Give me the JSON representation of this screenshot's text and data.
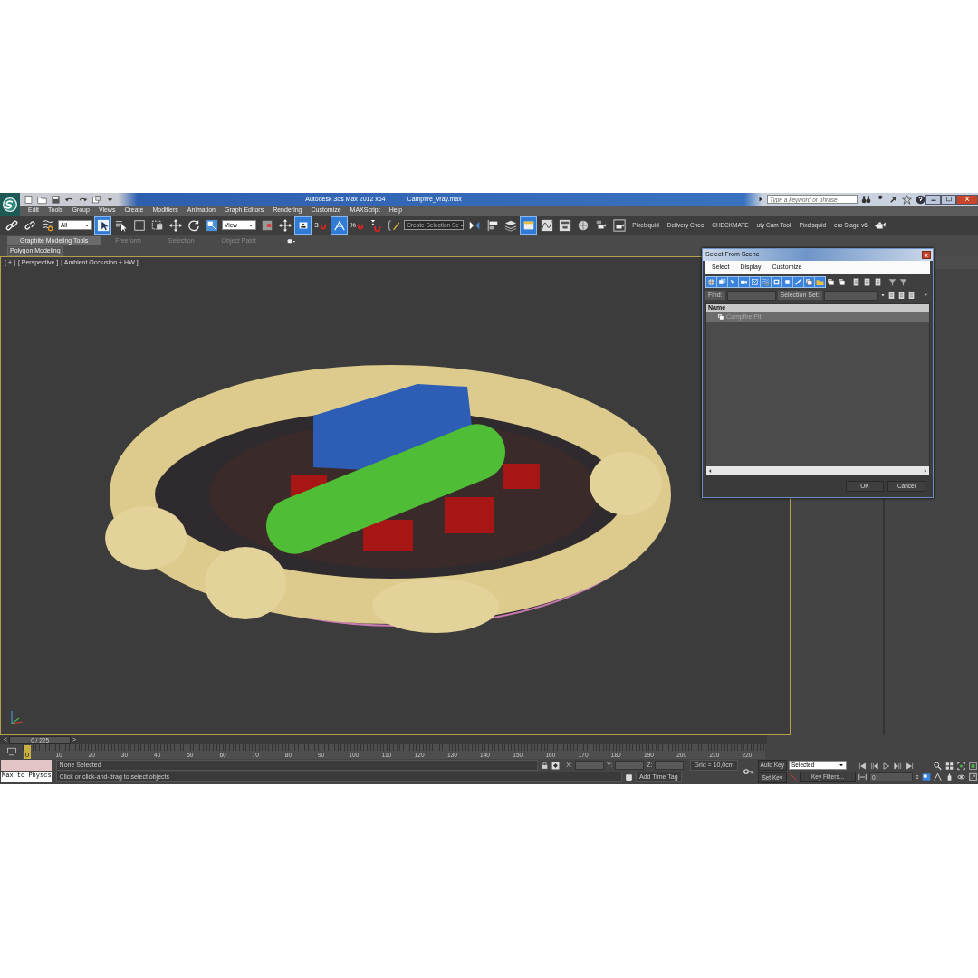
{
  "title_bar": {
    "title": "Autodesk 3ds Max  2012 x64",
    "file": "Campfire_vray.max",
    "search": {
      "placeholder": "Type a keyword or phrase"
    }
  },
  "menu": [
    "Edit",
    "Tools",
    "Group",
    "Views",
    "Create",
    "Modifiers",
    "Animation",
    "Graph Editors",
    "Rendering",
    "Customize",
    "MAXScript",
    "Help"
  ],
  "toolbar": [
    {
      "kind": "chain",
      "pressed": false
    },
    {
      "kind": "broken-chain",
      "pressed": false
    },
    {
      "kind": "wave",
      "pressed": false
    },
    {
      "kind": "dropdown",
      "value": "All"
    },
    {
      "kind": "cursor",
      "pressed": true
    },
    {
      "kind": "list-cursor",
      "pressed": false
    },
    {
      "kind": "square",
      "pressed": false
    },
    {
      "kind": "crossing",
      "pressed": false
    },
    {
      "kind": "move",
      "pressed": false
    },
    {
      "kind": "rotate",
      "pressed": false
    },
    {
      "kind": "scale",
      "pressed": false
    },
    {
      "kind": "dropdown",
      "value": "View"
    },
    {
      "kind": "pivot",
      "pressed": false
    },
    {
      "kind": "move",
      "pressed": false
    },
    {
      "kind": "keyboard",
      "pressed": true
    },
    {
      "kind": "magnet",
      "label": "3",
      "pressed": false
    },
    {
      "kind": "angle-magnet",
      "pressed": true
    },
    {
      "kind": "magnet",
      "label": "%",
      "pressed": false
    },
    {
      "kind": "spinner-magnet",
      "pressed": false
    },
    {
      "kind": "pencil",
      "pressed": false
    },
    {
      "kind": "dark-dropdown",
      "value": "Create Selection Se"
    },
    {
      "kind": "mirror",
      "pressed": false
    },
    {
      "kind": "align",
      "pressed": false
    },
    {
      "kind": "layers",
      "pressed": false
    },
    {
      "kind": "ribbon",
      "pressed": true
    },
    {
      "kind": "curve",
      "pressed": false
    },
    {
      "kind": "schematic",
      "pressed": false
    },
    {
      "kind": "sphere",
      "pressed": false
    },
    {
      "kind": "teapot-box",
      "pressed": false
    },
    {
      "kind": "teapot-frame",
      "pressed": false
    },
    {
      "kind": "script",
      "label": "Pixelsquid"
    },
    {
      "kind": "script",
      "label": "Delivery Chec"
    },
    {
      "kind": "script",
      "label": "CHECKMATE"
    },
    {
      "kind": "script",
      "label": "uty Cam Tool"
    },
    {
      "kind": "script",
      "label": "Pixelsquid"
    },
    {
      "kind": "script",
      "label": "ero Stage v6"
    },
    {
      "kind": "teapot",
      "pressed": false
    }
  ],
  "ribbon": {
    "tabs": [
      {
        "label": "Graphite Modeling Tools",
        "selected": true
      },
      {
        "label": "Freeform",
        "selected": false
      },
      {
        "label": "Selection",
        "selected": false
      },
      {
        "label": "Object Paint",
        "selected": false
      }
    ],
    "panel": "Polygon Modeling"
  },
  "viewport": {
    "labels": [
      "[ + ]",
      "[ Perspective ]",
      "[ Ambient Occlusion + HW ]"
    ],
    "active": true,
    "scene": {
      "kind": "picture"
    }
  },
  "dialog": {
    "title": "Select From Scene",
    "menu": [
      "Select",
      "Display",
      "Customize"
    ],
    "tools": [
      {
        "kind": "sphere",
        "pressed": true
      },
      {
        "kind": "shapes",
        "pressed": true
      },
      {
        "kind": "lamp",
        "pressed": true
      },
      {
        "kind": "camera",
        "pressed": true
      },
      {
        "kind": "helper",
        "pressed": true
      },
      {
        "kind": "wave",
        "pressed": true
      },
      {
        "kind": "group",
        "pressed": true
      },
      {
        "kind": "box",
        "pressed": true
      },
      {
        "kind": "bone",
        "pressed": true
      },
      {
        "kind": "stack",
        "pressed": true
      },
      {
        "kind": "folder",
        "pressed": true
      },
      {
        "kind": "stack",
        "pressed": false
      },
      {
        "kind": "stack",
        "pressed": false
      },
      {
        "kind": "page",
        "pressed": false
      },
      {
        "kind": "page",
        "pressed": false
      },
      {
        "kind": "page",
        "pressed": false
      },
      {
        "kind": "funnel",
        "pressed": false
      },
      {
        "kind": "funnel",
        "pressed": false
      }
    ],
    "find_label": "Find:",
    "set_label": "Selection Set:",
    "column": "Name",
    "rows": [
      {
        "name": "Campfire Pit",
        "selected": true
      }
    ],
    "buttons": [
      "OK",
      "Cancel"
    ]
  },
  "time_slider": {
    "prev": "<",
    "position": "0 / 225",
    "next": ">"
  },
  "track_bar": {
    "marker": "0",
    "ticks": [
      "10",
      "20",
      "30",
      "40",
      "50",
      "60",
      "70",
      "80",
      "90",
      "100",
      "110",
      "120",
      "130",
      "140",
      "150",
      "160",
      "170",
      "180",
      "190",
      "200",
      "210",
      "220"
    ]
  },
  "status": {
    "listener": "Max to Physcs",
    "selection": "None Selected",
    "prompt": "Click or click-and-drag to select objects",
    "coords": [
      "X:",
      "Y:",
      "Z:"
    ],
    "grid": "Grid = 10,0cm",
    "time_tag": "Add Time Tag"
  },
  "animation": {
    "auto_key": "Auto Key",
    "key_mode": "Selected",
    "set_key": "Set Key",
    "key_filters": "Key Filters...",
    "frame": "0"
  }
}
